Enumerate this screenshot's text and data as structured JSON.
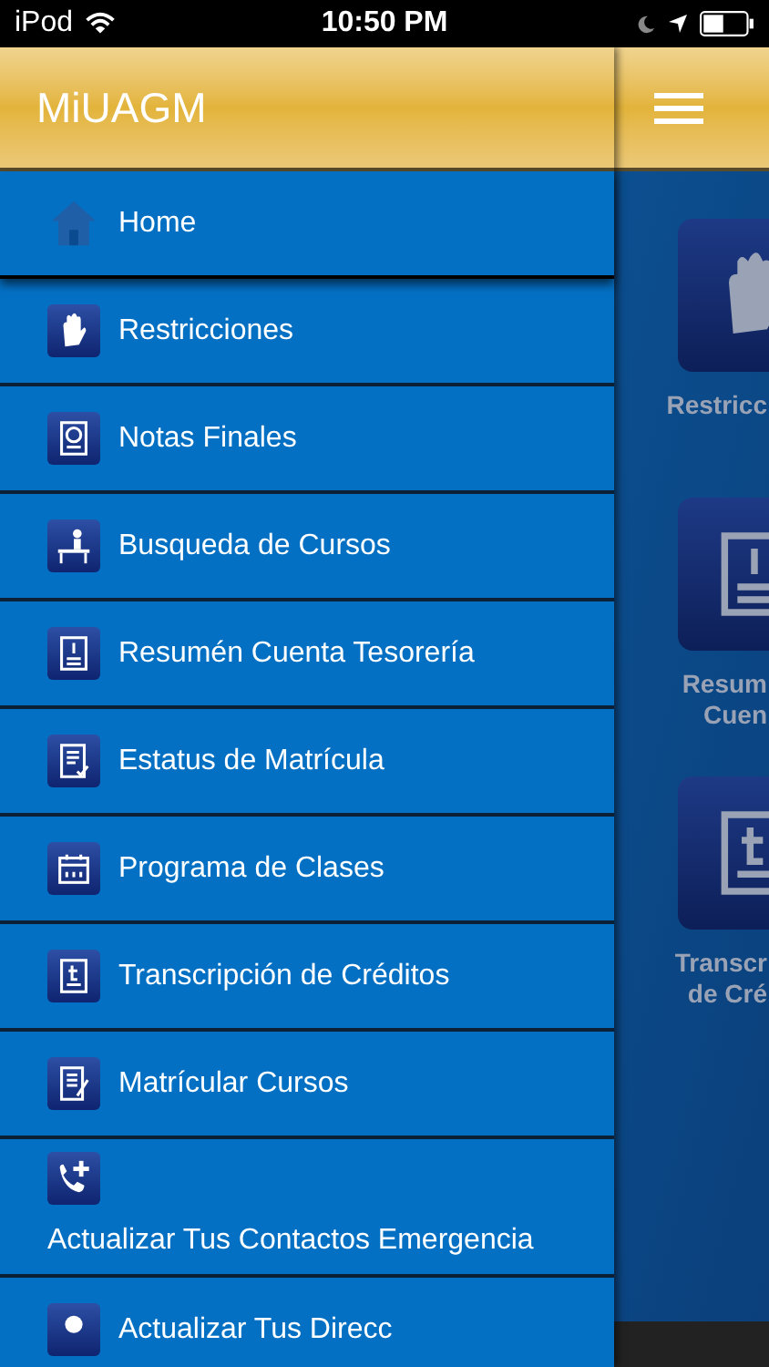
{
  "status_bar": {
    "carrier": "iPod",
    "time": "10:50 PM"
  },
  "drawer": {
    "title": "MiUAGM",
    "items": [
      {
        "label": "Home",
        "kind": "home",
        "selected": true
      },
      {
        "label": "Restricciones",
        "kind": "hand",
        "selected": false
      },
      {
        "label": "Notas Finales",
        "kind": "grades",
        "selected": false
      },
      {
        "label": "Busqueda de Cursos",
        "kind": "desk",
        "selected": false
      },
      {
        "label": "Resumén Cuenta Tesorería",
        "kind": "bill",
        "selected": false
      },
      {
        "label": "Estatus de Matrícula",
        "kind": "status",
        "selected": false
      },
      {
        "label": "Programa de Clases",
        "kind": "calendar",
        "selected": false
      },
      {
        "label": "Transcripción de Créditos",
        "kind": "transcript",
        "selected": false
      },
      {
        "label": "Matrícular Cursos",
        "kind": "enroll",
        "selected": false
      },
      {
        "label": "Actualizar Tus Contactos Emergencia",
        "kind": "phone",
        "selected": false
      },
      {
        "label": "Actualizar Tus Direcc",
        "kind": "pin",
        "selected": false
      }
    ]
  },
  "background": {
    "tiles": [
      {
        "kind": "hand",
        "lines": [
          "Restricc"
        ]
      },
      {
        "kind": "bill",
        "lines": [
          "Resum",
          "Cuen"
        ]
      },
      {
        "kind": "transcript",
        "lines": [
          "Transcr",
          "de Cré"
        ]
      }
    ]
  }
}
